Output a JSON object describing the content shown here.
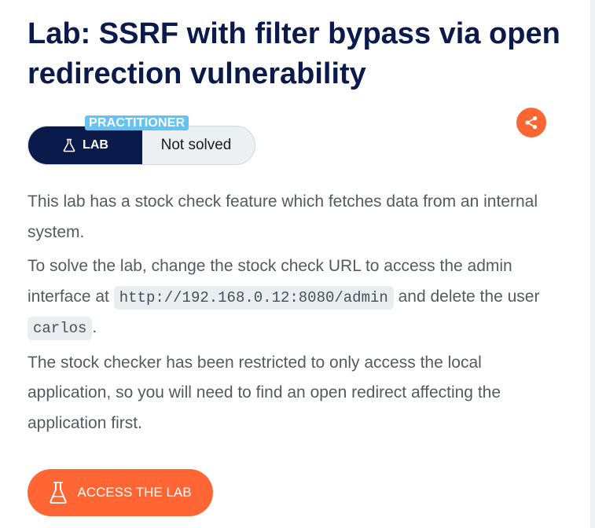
{
  "lab": {
    "title": "Lab: SSRF with filter bypass via open redirection vulnerability",
    "level": "PRACTITIONER",
    "badge_label": "LAB",
    "status": "Not solved",
    "share_icon": "share-icon"
  },
  "description": {
    "p1": "This lab has a stock check feature which fetches data from an internal system.",
    "p2_before": "To solve the lab, change the stock check URL to access the admin interface at ",
    "p2_url": "http://192.168.0.12:8080/admin",
    "p2_middle": " and delete the user ",
    "p2_user": "carlos",
    "p2_after": ".",
    "p3": "The stock checker has been restricted to only access the local application, so you will need to find an open redirect affecting the application first."
  },
  "access_button": {
    "label": "ACCESS THE LAB",
    "icon": "flask-icon"
  },
  "colors": {
    "title": "#0a1a4b",
    "accent": "#ff6633",
    "level_tag": "#62c3f5",
    "body_text": "#555a61"
  }
}
